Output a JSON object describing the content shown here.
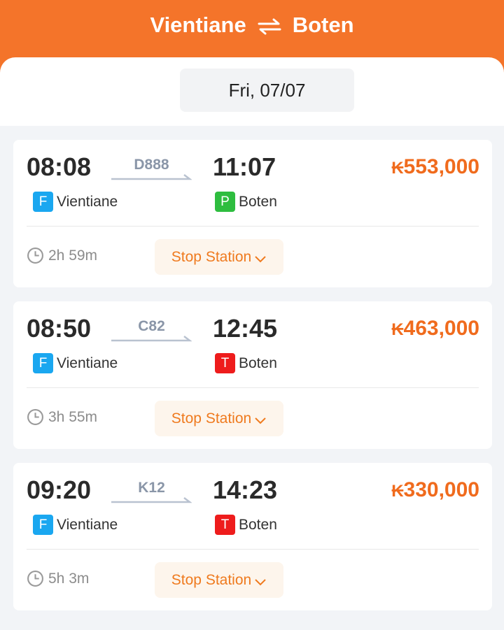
{
  "header": {
    "origin": "Vientiane",
    "destination": "Boten",
    "swap_icon": "swap-arrows-icon",
    "background": "#f4742a"
  },
  "date": {
    "label": "Fri, 07/07"
  },
  "trains": [
    {
      "departure_time": "08:08",
      "train_number": "D888",
      "arrival_time": "11:07",
      "currency": "₭",
      "price": "553,000",
      "departure_badge": "F",
      "departure_badge_color": "#1aa7f0",
      "departure_station": "Vientiane",
      "arrival_badge": "P",
      "arrival_badge_color": "#2ebd3f",
      "arrival_station": "Boten",
      "duration": "2h 59m",
      "stop_label": "Stop Station"
    },
    {
      "departure_time": "08:50",
      "train_number": "C82",
      "arrival_time": "12:45",
      "currency": "₭",
      "price": "463,000",
      "departure_badge": "F",
      "departure_badge_color": "#1aa7f0",
      "departure_station": "Vientiane",
      "arrival_badge": "T",
      "arrival_badge_color": "#ee1c1c",
      "arrival_station": "Boten",
      "duration": "3h 55m",
      "stop_label": "Stop Station"
    },
    {
      "departure_time": "09:20",
      "train_number": "K12",
      "arrival_time": "14:23",
      "currency": "₭",
      "price": "330,000",
      "departure_badge": "F",
      "departure_badge_color": "#1aa7f0",
      "departure_station": "Vientiane",
      "arrival_badge": "T",
      "arrival_badge_color": "#ee1c1c",
      "arrival_station": "Boten",
      "duration": "5h 3m",
      "stop_label": "Stop Station"
    }
  ]
}
